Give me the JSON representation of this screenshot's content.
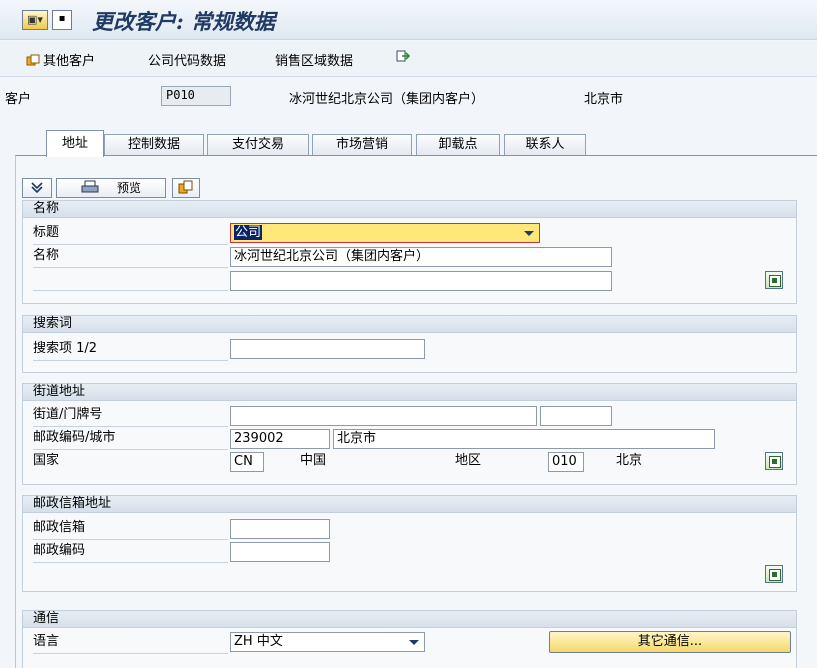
{
  "title": "更改客户: 常规数据",
  "toolbar": {
    "other_customer": "其他客户",
    "company_code_data": "公司代码数据",
    "sales_area_data": "销售区域数据"
  },
  "header": {
    "customer_label": "客户",
    "customer_id": "P010",
    "customer_name": "冰河世纪北京公司（集团内客户）",
    "city": "北京市"
  },
  "tabs": [
    {
      "label": "地址"
    },
    {
      "label": "控制数据"
    },
    {
      "label": "支付交易"
    },
    {
      "label": "市场营销"
    },
    {
      "label": "卸载点"
    },
    {
      "label": "联系人"
    }
  ],
  "panel_toolbar": {
    "preview": "预览"
  },
  "name_group": {
    "title": "名称",
    "title_label": "标题",
    "title_value": "公司",
    "name_label": "名称",
    "name_value": "冰河世纪北京公司（集团内客户）",
    "name2_value": ""
  },
  "search_group": {
    "title": "搜索词",
    "search_label": "搜索项 1/2",
    "search_value": ""
  },
  "street_group": {
    "title": "街道地址",
    "street_label": "街道/门牌号",
    "street_value": "",
    "house_value": "",
    "postal_city_label": "邮政编码/城市",
    "postal_code": "239002",
    "city": "北京市",
    "country_label": "国家",
    "country_code": "CN",
    "country_name": "中国",
    "region_label": "地区",
    "region_code": "010",
    "region_name": "北京"
  },
  "pobox_group": {
    "title": "邮政信箱地址",
    "pobox_label": "邮政信箱",
    "pobox_value": "",
    "postal_label": "邮政编码",
    "postal_value": ""
  },
  "comm_group": {
    "title": "通信",
    "language_label": "语言",
    "language_value": "ZH 中文",
    "other_comm_button": "其它通信..."
  },
  "colors": {
    "accent": "#1f3a63",
    "highlight_field": "#ffe77a",
    "button_yellow": "#f6d86b"
  }
}
